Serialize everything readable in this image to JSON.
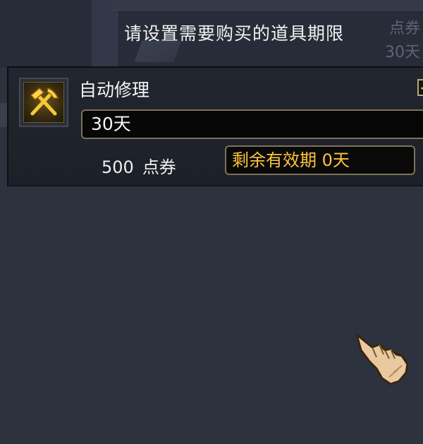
{
  "dialog": {
    "prompt": "请设置需要购买的道具期限"
  },
  "background": {
    "right_price_unit": "点券",
    "right_price_period": "30天"
  },
  "item": {
    "name": "自动修理",
    "icon": "hammer-pickaxe-icon",
    "checkbox": "checkbox-icon",
    "period_selected": "30天",
    "price_value": "500",
    "price_unit": "点券",
    "remaining_label": "剩余有效期 0天"
  },
  "colors": {
    "background": "#2d323f",
    "panel": "#1e222a",
    "remaining_text": "#ffc53a",
    "field_border": "#7c7257"
  }
}
